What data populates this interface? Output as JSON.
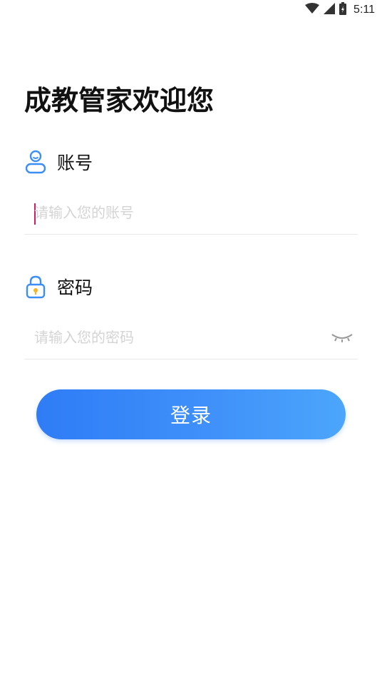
{
  "status_bar": {
    "time": "5:11",
    "icons": [
      "wifi-icon",
      "cellular-signal-icon",
      "battery-icon"
    ]
  },
  "page": {
    "title": "成教管家欢迎您"
  },
  "account": {
    "label": "账号",
    "icon": "user-icon",
    "placeholder": "请输入您的账号",
    "value": ""
  },
  "password": {
    "label": "密码",
    "icon": "lock-icon",
    "placeholder": "请输入您的密码",
    "value": "",
    "toggle_icon": "eye-closed-icon"
  },
  "login": {
    "label": "登录"
  },
  "colors": {
    "accent": "#3F8CF8",
    "gradient_start": "#2F7CF6",
    "gradient_end": "#4CA6FB",
    "caret": "#D81B60",
    "lock_fill": "#F5B623",
    "placeholder": "#D4D4D4",
    "divider": "#E8E8E8"
  }
}
